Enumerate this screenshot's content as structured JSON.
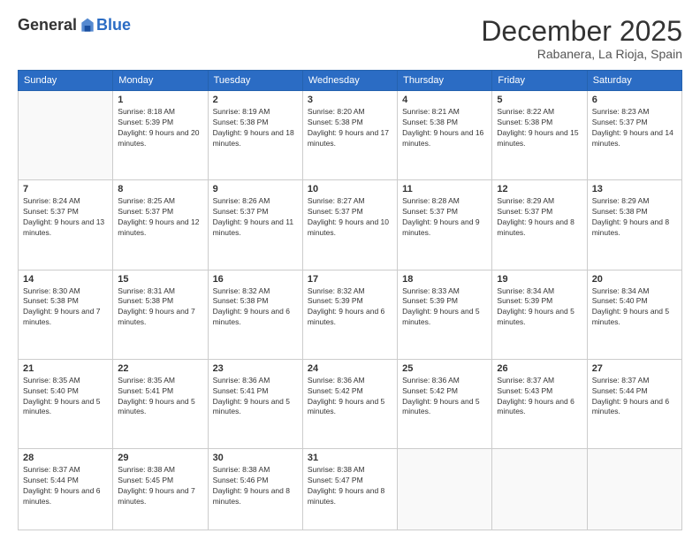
{
  "logo": {
    "general": "General",
    "blue": "Blue"
  },
  "title": "December 2025",
  "location": "Rabanera, La Rioja, Spain",
  "weekdays": [
    "Sunday",
    "Monday",
    "Tuesday",
    "Wednesday",
    "Thursday",
    "Friday",
    "Saturday"
  ],
  "weeks": [
    [
      {
        "day": "",
        "sunrise": "",
        "sunset": "",
        "daylight": ""
      },
      {
        "day": "1",
        "sunrise": "Sunrise: 8:18 AM",
        "sunset": "Sunset: 5:39 PM",
        "daylight": "Daylight: 9 hours and 20 minutes."
      },
      {
        "day": "2",
        "sunrise": "Sunrise: 8:19 AM",
        "sunset": "Sunset: 5:38 PM",
        "daylight": "Daylight: 9 hours and 18 minutes."
      },
      {
        "day": "3",
        "sunrise": "Sunrise: 8:20 AM",
        "sunset": "Sunset: 5:38 PM",
        "daylight": "Daylight: 9 hours and 17 minutes."
      },
      {
        "day": "4",
        "sunrise": "Sunrise: 8:21 AM",
        "sunset": "Sunset: 5:38 PM",
        "daylight": "Daylight: 9 hours and 16 minutes."
      },
      {
        "day": "5",
        "sunrise": "Sunrise: 8:22 AM",
        "sunset": "Sunset: 5:38 PM",
        "daylight": "Daylight: 9 hours and 15 minutes."
      },
      {
        "day": "6",
        "sunrise": "Sunrise: 8:23 AM",
        "sunset": "Sunset: 5:37 PM",
        "daylight": "Daylight: 9 hours and 14 minutes."
      }
    ],
    [
      {
        "day": "7",
        "sunrise": "Sunrise: 8:24 AM",
        "sunset": "Sunset: 5:37 PM",
        "daylight": "Daylight: 9 hours and 13 minutes."
      },
      {
        "day": "8",
        "sunrise": "Sunrise: 8:25 AM",
        "sunset": "Sunset: 5:37 PM",
        "daylight": "Daylight: 9 hours and 12 minutes."
      },
      {
        "day": "9",
        "sunrise": "Sunrise: 8:26 AM",
        "sunset": "Sunset: 5:37 PM",
        "daylight": "Daylight: 9 hours and 11 minutes."
      },
      {
        "day": "10",
        "sunrise": "Sunrise: 8:27 AM",
        "sunset": "Sunset: 5:37 PM",
        "daylight": "Daylight: 9 hours and 10 minutes."
      },
      {
        "day": "11",
        "sunrise": "Sunrise: 8:28 AM",
        "sunset": "Sunset: 5:37 PM",
        "daylight": "Daylight: 9 hours and 9 minutes."
      },
      {
        "day": "12",
        "sunrise": "Sunrise: 8:29 AM",
        "sunset": "Sunset: 5:37 PM",
        "daylight": "Daylight: 9 hours and 8 minutes."
      },
      {
        "day": "13",
        "sunrise": "Sunrise: 8:29 AM",
        "sunset": "Sunset: 5:38 PM",
        "daylight": "Daylight: 9 hours and 8 minutes."
      }
    ],
    [
      {
        "day": "14",
        "sunrise": "Sunrise: 8:30 AM",
        "sunset": "Sunset: 5:38 PM",
        "daylight": "Daylight: 9 hours and 7 minutes."
      },
      {
        "day": "15",
        "sunrise": "Sunrise: 8:31 AM",
        "sunset": "Sunset: 5:38 PM",
        "daylight": "Daylight: 9 hours and 7 minutes."
      },
      {
        "day": "16",
        "sunrise": "Sunrise: 8:32 AM",
        "sunset": "Sunset: 5:38 PM",
        "daylight": "Daylight: 9 hours and 6 minutes."
      },
      {
        "day": "17",
        "sunrise": "Sunrise: 8:32 AM",
        "sunset": "Sunset: 5:39 PM",
        "daylight": "Daylight: 9 hours and 6 minutes."
      },
      {
        "day": "18",
        "sunrise": "Sunrise: 8:33 AM",
        "sunset": "Sunset: 5:39 PM",
        "daylight": "Daylight: 9 hours and 5 minutes."
      },
      {
        "day": "19",
        "sunrise": "Sunrise: 8:34 AM",
        "sunset": "Sunset: 5:39 PM",
        "daylight": "Daylight: 9 hours and 5 minutes."
      },
      {
        "day": "20",
        "sunrise": "Sunrise: 8:34 AM",
        "sunset": "Sunset: 5:40 PM",
        "daylight": "Daylight: 9 hours and 5 minutes."
      }
    ],
    [
      {
        "day": "21",
        "sunrise": "Sunrise: 8:35 AM",
        "sunset": "Sunset: 5:40 PM",
        "daylight": "Daylight: 9 hours and 5 minutes."
      },
      {
        "day": "22",
        "sunrise": "Sunrise: 8:35 AM",
        "sunset": "Sunset: 5:41 PM",
        "daylight": "Daylight: 9 hours and 5 minutes."
      },
      {
        "day": "23",
        "sunrise": "Sunrise: 8:36 AM",
        "sunset": "Sunset: 5:41 PM",
        "daylight": "Daylight: 9 hours and 5 minutes."
      },
      {
        "day": "24",
        "sunrise": "Sunrise: 8:36 AM",
        "sunset": "Sunset: 5:42 PM",
        "daylight": "Daylight: 9 hours and 5 minutes."
      },
      {
        "day": "25",
        "sunrise": "Sunrise: 8:36 AM",
        "sunset": "Sunset: 5:42 PM",
        "daylight": "Daylight: 9 hours and 5 minutes."
      },
      {
        "day": "26",
        "sunrise": "Sunrise: 8:37 AM",
        "sunset": "Sunset: 5:43 PM",
        "daylight": "Daylight: 9 hours and 6 minutes."
      },
      {
        "day": "27",
        "sunrise": "Sunrise: 8:37 AM",
        "sunset": "Sunset: 5:44 PM",
        "daylight": "Daylight: 9 hours and 6 minutes."
      }
    ],
    [
      {
        "day": "28",
        "sunrise": "Sunrise: 8:37 AM",
        "sunset": "Sunset: 5:44 PM",
        "daylight": "Daylight: 9 hours and 6 minutes."
      },
      {
        "day": "29",
        "sunrise": "Sunrise: 8:38 AM",
        "sunset": "Sunset: 5:45 PM",
        "daylight": "Daylight: 9 hours and 7 minutes."
      },
      {
        "day": "30",
        "sunrise": "Sunrise: 8:38 AM",
        "sunset": "Sunset: 5:46 PM",
        "daylight": "Daylight: 9 hours and 8 minutes."
      },
      {
        "day": "31",
        "sunrise": "Sunrise: 8:38 AM",
        "sunset": "Sunset: 5:47 PM",
        "daylight": "Daylight: 9 hours and 8 minutes."
      },
      {
        "day": "",
        "sunrise": "",
        "sunset": "",
        "daylight": ""
      },
      {
        "day": "",
        "sunrise": "",
        "sunset": "",
        "daylight": ""
      },
      {
        "day": "",
        "sunrise": "",
        "sunset": "",
        "daylight": ""
      }
    ]
  ]
}
